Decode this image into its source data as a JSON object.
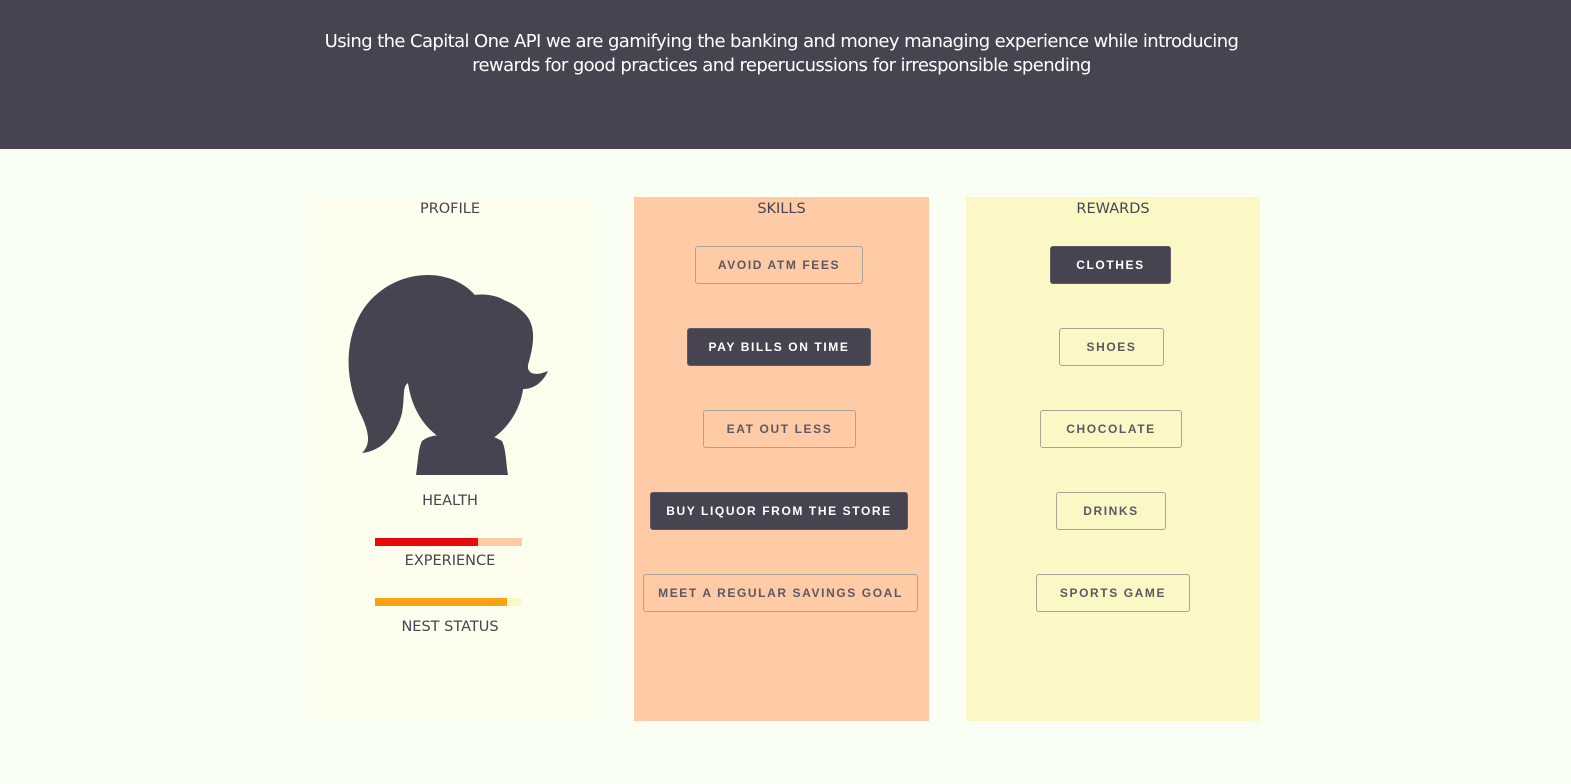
{
  "header": {
    "tagline_line1": "Using the Capital One API we are gamifying the banking and money managing experience while introducing",
    "tagline_line2": "rewards for good practices and reperucussions for irresponsible spending"
  },
  "profile": {
    "title": "PROFILE",
    "avatar_icon": "girl-silhouette-icon",
    "stats": [
      {
        "label": "HEALTH",
        "value": 0.7,
        "fill_color": "#e8090d",
        "track_color": "#fecba6"
      },
      {
        "label": "EXPERIENCE",
        "value": 0.9,
        "fill_color": "#f8a30f",
        "track_color": "#fbf8c5"
      },
      {
        "label": "NEST STATUS"
      }
    ]
  },
  "skills": {
    "title": "SKILLS",
    "items": [
      {
        "label": "AVOID ATM FEES",
        "selected": false
      },
      {
        "label": "PAY BILLS ON TIME",
        "selected": true
      },
      {
        "label": "EAT OUT LESS",
        "selected": false
      },
      {
        "label": "BUY LIQUOR FROM THE STORE",
        "selected": true
      },
      {
        "label": "MEET A REGULAR SAVINGS GOAL",
        "selected": false
      }
    ]
  },
  "rewards": {
    "title": "REWARDS",
    "items": [
      {
        "label": "CLOTHES",
        "selected": true
      },
      {
        "label": "SHOES",
        "selected": false
      },
      {
        "label": "CHOCOLATE",
        "selected": false
      },
      {
        "label": "DRINKS",
        "selected": false
      },
      {
        "label": "SPORTS GAME",
        "selected": false
      }
    ]
  },
  "colors": {
    "header_bg": "#474350",
    "page_bg": "#fafff3",
    "profile_bg": "#fdfeed",
    "skills_bg": "#fecba6",
    "rewards_bg": "#fbf8c5",
    "accent_dark": "#474350"
  }
}
